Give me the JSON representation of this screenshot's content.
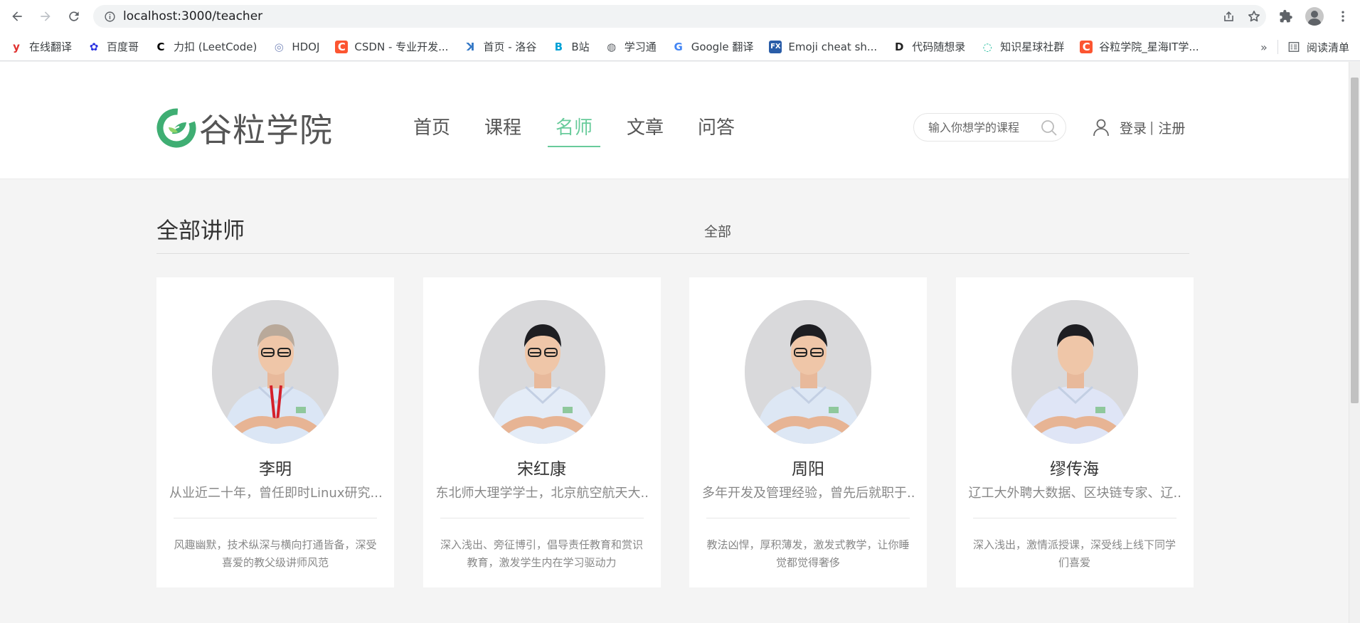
{
  "browser": {
    "url": "localhost:3000/teacher",
    "bookmarks": [
      {
        "label": "在线翻译",
        "icon": "youdao-icon",
        "color": "#e0312f",
        "glyph": "y"
      },
      {
        "label": "百度哥",
        "icon": "baidu-icon",
        "color": "#2932e1",
        "glyph": "✿"
      },
      {
        "label": "力扣 (LeetCode)",
        "icon": "leetcode-icon",
        "color": "#000000",
        "glyph": "C"
      },
      {
        "label": "HDOJ",
        "icon": "hdoj-icon",
        "color": "#7f8fbf",
        "glyph": "◎"
      },
      {
        "label": "CSDN - 专业开发...",
        "icon": "csdn-icon",
        "color": "#fc5531",
        "glyph": "C"
      },
      {
        "label": "首页 - 洛谷",
        "icon": "luogu-icon",
        "color": "#3478c6",
        "glyph": "ꓘ"
      },
      {
        "label": "B站",
        "icon": "bilibili-icon",
        "color": "#00a1d6",
        "glyph": "B"
      },
      {
        "label": "学习通",
        "icon": "globe-icon",
        "color": "#5f6368",
        "glyph": "◍"
      },
      {
        "label": "Google 翻译",
        "icon": "google-translate-icon",
        "color": "#4285f4",
        "glyph": "G"
      },
      {
        "label": "Emoji cheat sh...",
        "icon": "emoji-icon",
        "color": "#2a5da8",
        "glyph": "FX"
      },
      {
        "label": "代码随想录",
        "icon": "code-icon",
        "color": "#222222",
        "glyph": "D"
      },
      {
        "label": "知识星球社群",
        "icon": "zsxq-icon",
        "color": "#16b998",
        "glyph": "◌"
      },
      {
        "label": "谷粒学院_星海IT学...",
        "icon": "csdn-icon",
        "color": "#fc5531",
        "glyph": "C"
      }
    ],
    "reading_list": "阅读清单",
    "more": "»"
  },
  "site": {
    "logo_text": "谷粒学院",
    "brand_color": "#68cb9b",
    "nav": [
      "首页",
      "课程",
      "名师",
      "文章",
      "问答"
    ],
    "active_nav": "名师",
    "search_placeholder": "输入你想学的课程",
    "login": "登录",
    "separator": "|",
    "register": "注册"
  },
  "section": {
    "title": "全部讲师",
    "filter": "全部"
  },
  "teachers": [
    {
      "name": "李明",
      "intro": "从业近二十年，曾任即时Linux研究...",
      "career": "风趣幽默，技术纵深与横向打通皆备，深受喜爱的教父级讲师风范"
    },
    {
      "name": "宋红康",
      "intro": "东北师大理学学士，北京航空航天大...",
      "career": "深入浅出、旁征博引，倡导责任教育和赏识教育，激发学生内在学习驱动力"
    },
    {
      "name": "周阳",
      "intro": "多年开发及管理经验，曾先后就职于...",
      "career": "教法凶悍，厚积薄发，激发式教学，让你睡觉都觉得奢侈"
    },
    {
      "name": "缪传海",
      "intro": "辽工大外聘大数据、区块链专家、辽...",
      "career": "深入浅出，激情派授课，深受线上线下同学们喜爱"
    }
  ]
}
